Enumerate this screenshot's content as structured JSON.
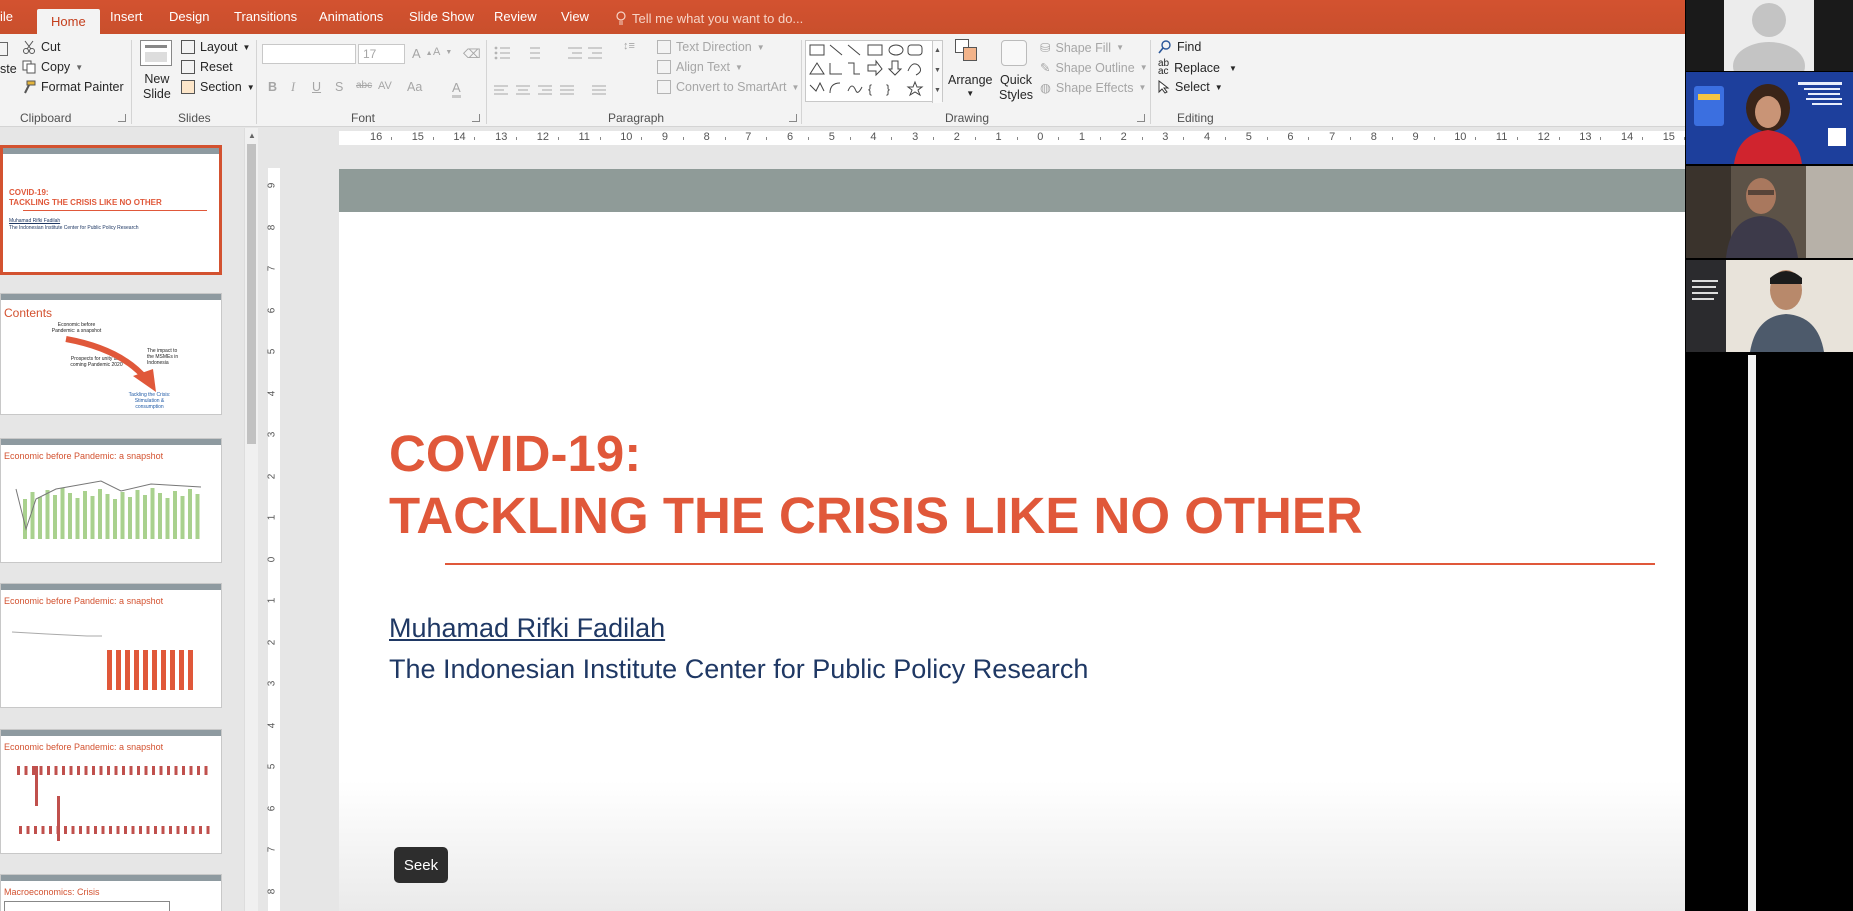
{
  "tabs": [
    "ile",
    "Home",
    "Insert",
    "Design",
    "Transitions",
    "Animations",
    "Slide Show",
    "Review",
    "View"
  ],
  "active_tab": "Home",
  "tell_me": "Tell me what you want to do...",
  "clipboard": {
    "paste": "ste",
    "cut": "Cut",
    "copy": "Copy",
    "format_painter": "Format Painter",
    "label": "Clipboard"
  },
  "slides_group": {
    "new_slide_1": "New",
    "new_slide_2": "Slide",
    "layout": "Layout",
    "reset": "Reset",
    "section": "Section",
    "label": "Slides"
  },
  "font_group": {
    "size": "17",
    "label": "Font",
    "bold": "B",
    "italic": "I",
    "underline": "U",
    "shadow": "S",
    "strike": "abc",
    "aa": "Aa",
    "color": "A"
  },
  "paragraph_group": {
    "text_direction": "Text Direction",
    "align_text": "Align Text",
    "convert": "Convert to SmartArt",
    "label": "Paragraph"
  },
  "drawing_group": {
    "arrange": "Arrange",
    "quick_styles_1": "Quick",
    "quick_styles_2": "Styles",
    "shape_fill": "Shape Fill",
    "shape_outline": "Shape Outline",
    "shape_effects": "Shape Effects",
    "label": "Drawing"
  },
  "editing_group": {
    "find": "Find",
    "replace": "Replace",
    "select": "Select",
    "label": "Editing"
  },
  "ruler_h": [
    "16",
    "15",
    "14",
    "13",
    "12",
    "11",
    "10",
    "9",
    "8",
    "7",
    "6",
    "5",
    "4",
    "3",
    "2",
    "1",
    "0",
    "1",
    "2",
    "3",
    "4",
    "5",
    "6",
    "7",
    "8",
    "9",
    "10",
    "11",
    "12",
    "13",
    "14",
    "15"
  ],
  "ruler_v": [
    "9",
    "8",
    "7",
    "6",
    "5",
    "4",
    "3",
    "2",
    "1",
    "0",
    "1",
    "2",
    "3",
    "4",
    "5",
    "6",
    "7",
    "8"
  ],
  "thumbnails": [
    {
      "title": "COVID-19:",
      "subtitle": "TACKLING THE CRISIS LIKE NO OTHER",
      "author": "Muhamad Rifki Fadilah",
      "inst": "The Indonesian Institute Center for Public Policy Research"
    },
    {
      "title": "Contents",
      "items": [
        "Economic before Pandemic: a snapshot",
        "The impact to the MSMEs in Indonesia",
        "Prospects for unity and coming Pandemic 2020",
        "Tackling the Crisis: Stimulation & consumption"
      ]
    },
    {
      "title": "Economic before Pandemic: a snapshot"
    },
    {
      "title": "Economic before Pandemic: a snapshot"
    },
    {
      "title": "Economic before Pandemic: a snapshot"
    },
    {
      "title": "Macroeconomics: Crisis"
    }
  ],
  "slide": {
    "title_line1": "COVID-19:",
    "title_line2": "TACKLING THE CRISIS LIKE NO OTHER",
    "author": "Muhamad Rifki Fadilah",
    "institution": "The Indonesian Institute Center for Public Policy Research"
  },
  "tooltip": "Seek",
  "colors": {
    "accent": "#d35230",
    "slide_title": "#e0583a",
    "slide_text": "#1f3864"
  }
}
